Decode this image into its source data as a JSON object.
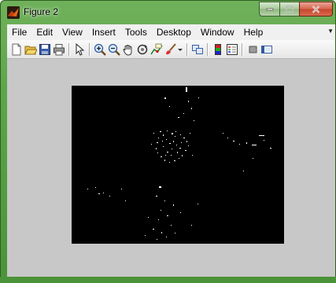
{
  "window": {
    "title": "Figure 2",
    "titlebar_color": "#5aa346",
    "client_background": "#c8c8c8",
    "plot_background": "#000000"
  },
  "menubar": {
    "items": [
      "File",
      "Edit",
      "View",
      "Insert",
      "Tools",
      "Desktop",
      "Window",
      "Help"
    ],
    "overflow_icon": "menu-overflow-arrow"
  },
  "toolbar": {
    "buttons": [
      "new-figure-icon",
      "open-file-icon",
      "save-figure-icon",
      "print-figure-icon",
      "edit-plot-arrow-icon",
      "zoom-in-icon",
      "zoom-out-icon",
      "pan-hand-icon",
      "rotate-3d-icon",
      "data-cursor-icon",
      "brush-icon",
      "brush-dropdown-icon",
      "link-plot-icon",
      "insert-colorbar-icon",
      "insert-legend-icon",
      "hide-plot-tools-icon",
      "show-plot-tools-icon"
    ]
  },
  "window_controls": [
    "minimize-button",
    "maximize-button",
    "close-button"
  ],
  "image": {
    "description_type": "binary edge map",
    "foreground_color": "#ffffff"
  }
}
